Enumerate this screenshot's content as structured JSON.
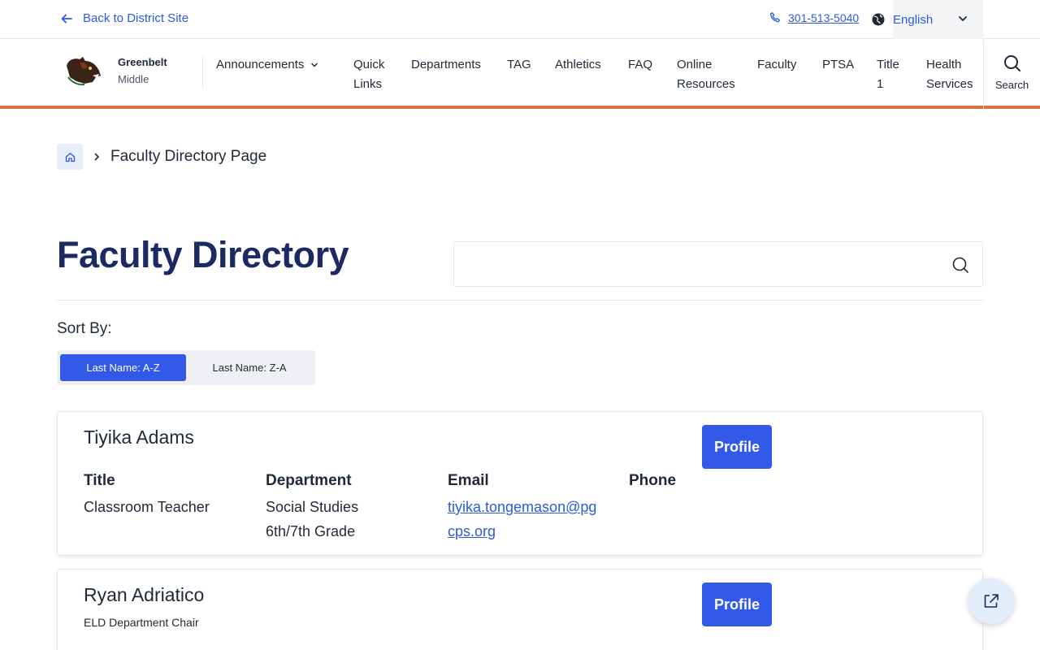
{
  "utility": {
    "back_label": "Back to District Site",
    "phone": "301-513-5040",
    "language": "English"
  },
  "school": {
    "name_line1": "Greenbelt",
    "name_line2": "Middle"
  },
  "nav": {
    "items": [
      {
        "label": "Announcements"
      },
      {
        "label": "Quick\nLinks"
      },
      {
        "label": "Departments"
      },
      {
        "label": "TAG"
      },
      {
        "label": "Athletics"
      },
      {
        "label": "FAQ"
      },
      {
        "label": "Online\nResources"
      },
      {
        "label": "Faculty"
      },
      {
        "label": "PTSA"
      },
      {
        "label": "Title\n1"
      },
      {
        "label": "Health\nServices"
      }
    ],
    "search_label": "Search"
  },
  "breadcrumb": {
    "current": "Faculty Directory Page"
  },
  "page": {
    "title": "Faculty Directory",
    "search_value": "",
    "sort_label": "Sort By:",
    "sort_options": [
      "Last Name: A-Z",
      "Last Name: Z-A"
    ],
    "sort_selected": "Last Name: A-Z"
  },
  "faculty": [
    {
      "name": "Tiyika Adams",
      "profile_label": "Profile",
      "headers": {
        "title": "Title",
        "department": "Department",
        "email": "Email",
        "phone": "Phone"
      },
      "title": "Classroom Teacher",
      "department_line1": "Social Studies",
      "department_line2": "6th/7th Grade",
      "email": "tiyika.tongemason@pgcps.org",
      "phone": ""
    },
    {
      "name": "Ryan Adriatico",
      "subtitle": "ELD Department Chair",
      "profile_label": "Profile"
    }
  ],
  "colors": {
    "accent_blue": "#3359e8",
    "link_blue": "#2b5bd7",
    "title_navy": "#1b2a63",
    "nav_border_orange": "#d9733f"
  }
}
